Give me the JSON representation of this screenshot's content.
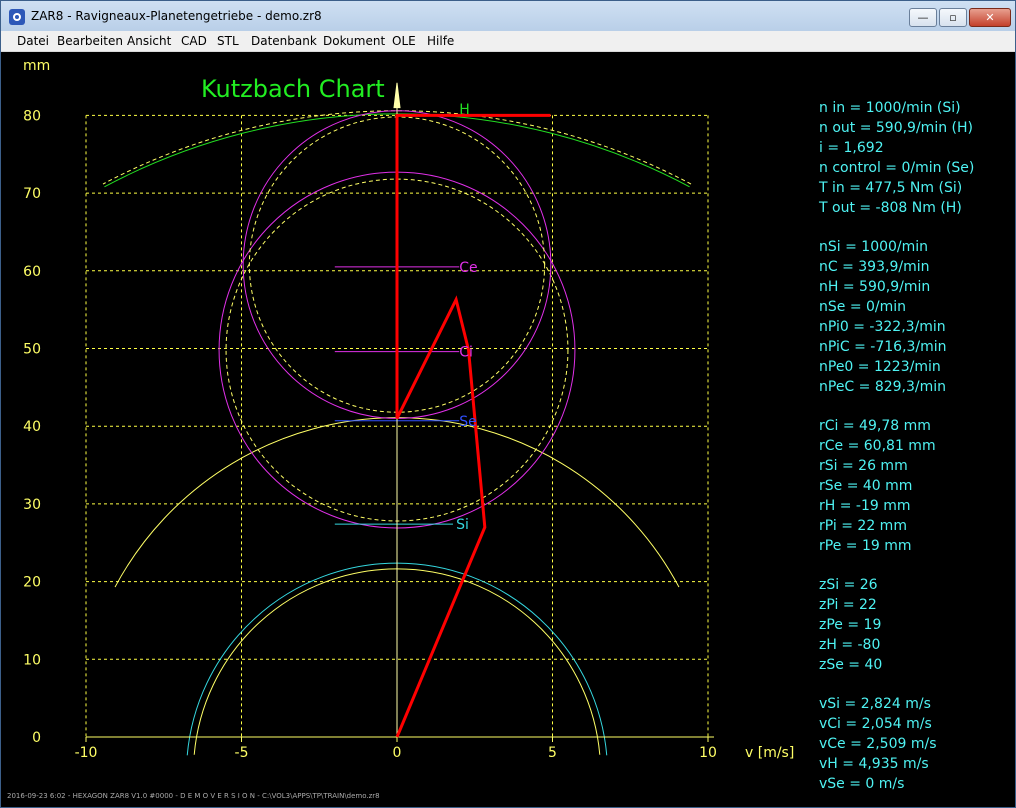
{
  "window": {
    "title": "ZAR8 - Ravigneaux-Planetengetriebe  -  demo.zr8",
    "minimize_glyph": "—",
    "maximize_glyph": "▫",
    "close_glyph": "✕"
  },
  "menu": [
    "Datei",
    "Bearbeiten",
    "Ansicht",
    "CAD",
    "STL",
    "Datenbank",
    "Dokument",
    "OLE",
    "Hilfe"
  ],
  "chart_data": {
    "type": "line",
    "title": "Kutzbach Chart",
    "ylabel": "mm",
    "xlabel": "v [m/s]",
    "xlim": [
      -10,
      10
    ],
    "ylim": [
      0,
      80
    ],
    "x_ticks": [
      "-10",
      "-5",
      "0",
      "5",
      "10"
    ],
    "y_ticks": [
      "0",
      "10",
      "20",
      "30",
      "40",
      "50",
      "60",
      "70",
      "80"
    ],
    "grid": true,
    "colors": {
      "grid": "#ffff44",
      "axis": "#ffff66",
      "speed_line": "#ff0000",
      "sun_inner": "#35d8e0",
      "planet": "#e030e8",
      "ring_gear": "#22dd22",
      "title": "#22ee22"
    },
    "speed_line": [
      {
        "x": 0,
        "y": 0
      },
      {
        "x": 2.824,
        "y": 27
      },
      {
        "x": 2.3,
        "y": 49.8
      },
      {
        "x": 1.9,
        "y": 56.3
      },
      {
        "x": 0,
        "y": 41
      },
      {
        "x": 0,
        "y": 80
      },
      {
        "x": 4.935,
        "y": 80
      }
    ],
    "gear_labels": [
      {
        "text": "H",
        "x": 2.0,
        "y": 80.8,
        "color": "#22dd22"
      },
      {
        "text": "Ce",
        "x": 2.0,
        "y": 60.5,
        "color": "#e030e8"
      },
      {
        "text": "Ci",
        "x": 2.0,
        "y": 49.6,
        "color": "#e030e8"
      },
      {
        "text": "Se",
        "x": 2.0,
        "y": 40.7,
        "color": "#3050ff"
      },
      {
        "text": "Si",
        "x": 1.9,
        "y": 27.4,
        "color": "#35d8e0"
      }
    ]
  },
  "results": {
    "summary": [
      "n in = 1000/min (Si)",
      "n out = 590,9/min (H)",
      "i = 1,692",
      "n control = 0/min (Se)",
      "T in = 477,5 Nm (Si)",
      "T out = -808 Nm (H)"
    ],
    "speeds": [
      "nSi = 1000/min",
      "nC = 393,9/min",
      "nH = 590,9/min",
      "nSe = 0/min",
      "nPi0 = -322,3/min",
      "nPiC = -716,3/min",
      "nPe0 = 1223/min",
      "nPeC = 829,3/min"
    ],
    "radii": [
      "rCi = 49,78 mm",
      "rCe = 60,81 mm",
      "rSi = 26 mm",
      "rSe = 40 mm",
      "rH = -19 mm",
      "rPi = 22 mm",
      "rPe = 19 mm"
    ],
    "teeth": [
      "zSi = 26",
      "zPi = 22",
      "zPe = 19",
      "zH = -80",
      "zSe = 40"
    ],
    "velocities": [
      "vSi = 2,824 m/s",
      "vCi = 2,054 m/s",
      "vCe = 2,509 m/s",
      "vH = 4,935 m/s",
      "vSe = 0 m/s"
    ]
  },
  "footer": "2016-09-23 6:02 - HEXAGON ZAR8 V1.0 #0000 - D E M O V E R S I O N - C:\\VOL3\\APPS\\TP\\TRAIN\\demo.zr8"
}
